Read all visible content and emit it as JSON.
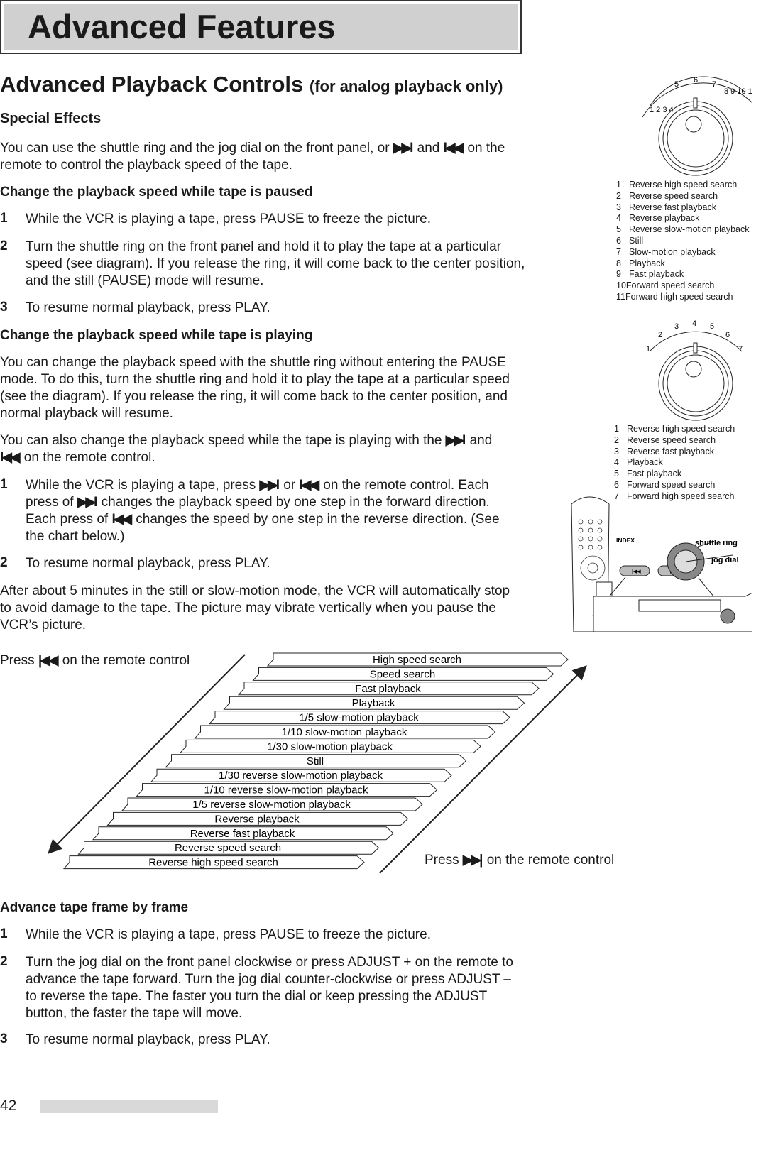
{
  "header": {
    "title": "Advanced Features"
  },
  "icons": {
    "ff": "▶▶I",
    "rew": "I◀◀",
    "ff_bar": "▶▶|",
    "rew_bar": "|◀◀"
  },
  "section": {
    "title": "Advanced Playback Controls",
    "title_note": "(for analog playback only)",
    "subtitle": "Special Effects",
    "intro_a": "You can use the shuttle ring and the jog dial on the front panel, or",
    "intro_b": "and",
    "intro_c": "on the remote to control the playback speed of the tape."
  },
  "paused": {
    "heading": "Change the playback speed while tape is paused",
    "steps": [
      {
        "n": "1",
        "text": "While the VCR is playing a tape, press PAUSE to freeze the picture."
      },
      {
        "n": "2",
        "text": "Turn the shuttle ring on the front panel and hold it to play the tape at a particular speed (see diagram).  If you release the ring, it will come back to the center position, and the still (PAUSE) mode will resume."
      },
      {
        "n": "3",
        "text": "To resume normal playback, press PLAY."
      }
    ]
  },
  "playing": {
    "heading": "Change the playback speed while tape is playing",
    "para1": "You can change the playback speed with the shuttle ring without entering the PAUSE mode.  To do this, turn the shuttle ring and hold it to play the tape at a particular speed (see the diagram).  If you release the ring, it will come back to the center position, and normal playback will resume.",
    "para2_a": "You can also change the playback speed while the tape is playing with the",
    "para2_b": "and",
    "para2_c": "on the remote control.",
    "step1_a": "While the VCR is playing a tape, press",
    "step1_b": "or",
    "step1_c": "on the remote control. Each press of",
    "step1_d": "changes the playback speed by one step in the forward direction.  Each press of",
    "step1_e": "changes the speed by one step in the reverse direction.  (See the chart below.)",
    "step2": "To resume normal playback, press PLAY.",
    "para3": "After about 5 minutes in the still or slow-motion mode, the VCR will automatically stop to avoid damage to the tape.  The picture may vibrate vertically when you pause the VCR’s picture."
  },
  "dial1": {
    "items": [
      "Reverse high speed search",
      "Reverse speed search",
      "Reverse fast playback",
      "Reverse playback",
      "Reverse slow-motion playback",
      "Still",
      "Slow-motion playback",
      "Playback",
      "Fast playback",
      "Forward speed search",
      "Forward high speed search"
    ]
  },
  "dial2": {
    "items": [
      "Reverse high speed search",
      "Reverse speed search",
      "Reverse fast playback",
      "Playback",
      "Fast playback",
      "Forward speed search",
      "Forward high speed search"
    ]
  },
  "illustration": {
    "index_label": "INDEX",
    "shuttle_label": "shuttle ring",
    "jog_label": "jog dial"
  },
  "chart": {
    "press_rew": "Press",
    "press_rew_tail": "on the remote control",
    "press_ff": "Press",
    "press_ff_tail": "on the remote control",
    "steps": [
      "High speed search",
      "Speed search",
      "Fast playback",
      "Playback",
      "1/5 slow-motion playback",
      "1/10 slow-motion playback",
      "1/30 slow-motion playback",
      "Still",
      "1/30 reverse slow-motion playback",
      "1/10 reverse slow-motion playback",
      "1/5 reverse slow-motion playback",
      "Reverse playback",
      "Reverse fast playback",
      "Reverse speed search",
      "Reverse high speed search"
    ]
  },
  "frame": {
    "heading": "Advance tape frame by frame",
    "steps": [
      {
        "n": "1",
        "text": "While the VCR is playing a tape, press PAUSE to freeze the picture."
      },
      {
        "n": "2",
        "text": "Turn the jog dial on the front panel clockwise or press ADJUST + on the remote to advance the tape forward.  Turn the jog dial counter-clockwise or press ADJUST – to reverse the tape.  The faster you turn the dial or keep pressing the ADJUST button, the faster the tape will move."
      },
      {
        "n": "3",
        "text": "To resume normal playback, press PLAY."
      }
    ]
  },
  "footer": {
    "page": "42"
  }
}
